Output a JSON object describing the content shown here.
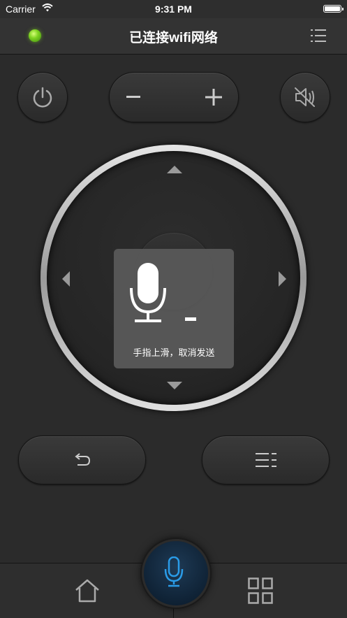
{
  "status_bar": {
    "carrier": "Carrier",
    "time": "9:31 PM",
    "wifi_icon": "wifi-icon",
    "battery_icon": "battery-icon"
  },
  "nav": {
    "title": "已连接wifi网络",
    "status_led_color": "#7ed321",
    "menu_icon": "list-menu-icon"
  },
  "controls": {
    "power_icon": "power-icon",
    "volume_down_icon": "minus-icon",
    "volume_up_icon": "plus-icon",
    "mute_icon": "mute-icon",
    "back_icon": "back-arrow-icon",
    "options_icon": "list-menu-icon"
  },
  "voice_overlay": {
    "hint": "手指上滑，取消发送",
    "icon": "microphone-icon"
  },
  "tab_bar": {
    "home_icon": "home-icon",
    "apps_icon": "grid-icon",
    "voice_icon": "microphone-icon",
    "accent_color": "#1e8fd6"
  }
}
